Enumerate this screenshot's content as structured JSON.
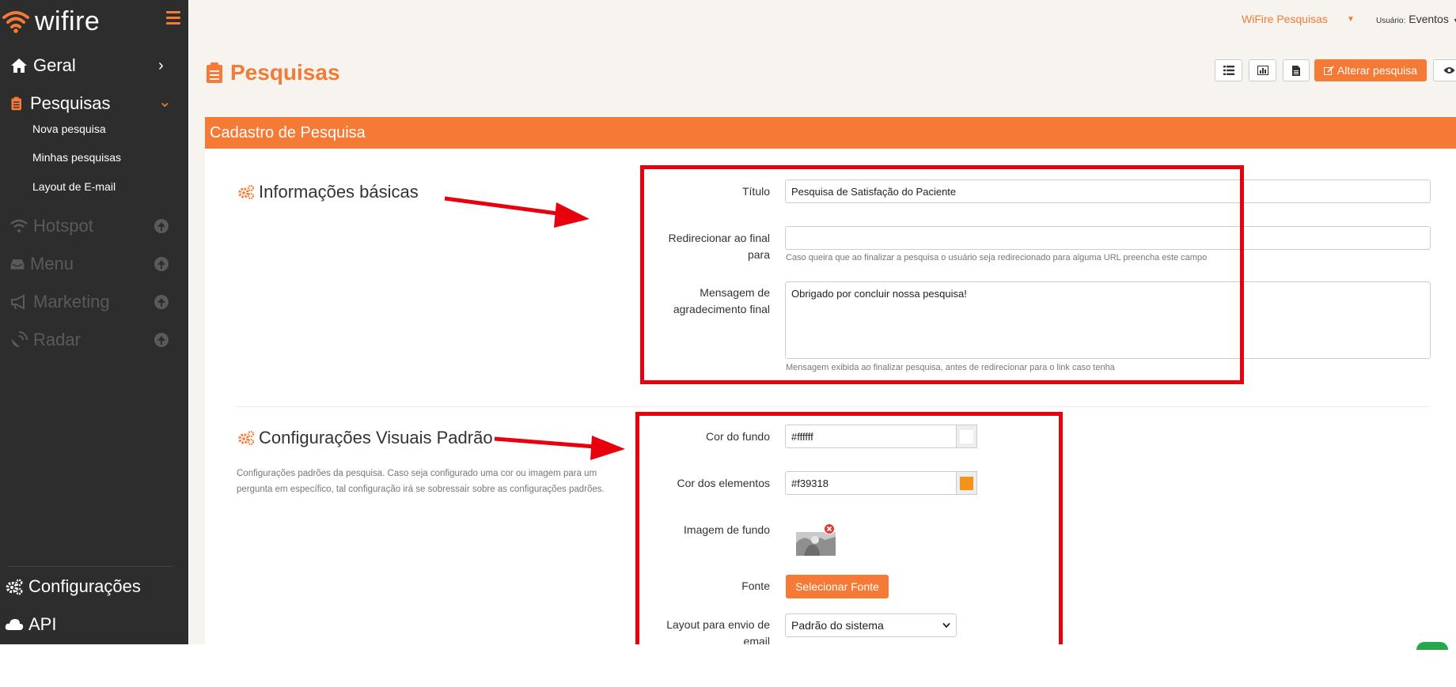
{
  "app": {
    "logo_text": "wifire"
  },
  "sidebar": {
    "items": [
      {
        "label": "Geral",
        "icon": "home-icon",
        "arrow": "›"
      },
      {
        "label": "Pesquisas",
        "icon": "clipboard-icon",
        "arrow": "⌄"
      },
      {
        "label": "Hotspot",
        "icon": "wifi-icon"
      },
      {
        "label": "Menu",
        "icon": "inbox-icon"
      },
      {
        "label": "Marketing",
        "icon": "bullhorn-icon"
      },
      {
        "label": "Radar",
        "icon": "satellite-icon"
      }
    ],
    "subitems": [
      "Nova pesquisa",
      "Minhas pesquisas",
      "Layout de E-mail"
    ],
    "bottom": [
      {
        "label": "Configurações",
        "icon": "cogs-icon"
      },
      {
        "label": "API",
        "icon": "cloud-icon"
      }
    ]
  },
  "topbar": {
    "company": "WiFire Pesquisas",
    "user_prefix": "Usuário:",
    "user_name": "Eventos"
  },
  "page": {
    "title": "Pesquisas",
    "alter_button": "Alterar pesquisa",
    "panel_title": "Cadastro de Pesquisa"
  },
  "basic": {
    "section_title": "Informações básicas",
    "titulo_label": "Título",
    "titulo_value": "Pesquisa de Satisfação do Paciente",
    "redirect_label_1": "Redirecionar ao final",
    "redirect_label_2": "para",
    "redirect_value": "",
    "redirect_help": "Caso queira que ao finalizar a pesquisa o usuário seja redirecionado para alguma URL preencha este campo",
    "msg_label_1": "Mensagem de",
    "msg_label_2": "agradecimento final",
    "msg_value": "Obrigado por concluir nossa pesquisa!",
    "msg_help": "Mensagem exibida ao finalizar pesquisa, antes de redirecionar para o link caso tenha"
  },
  "visual": {
    "section_title": "Configurações Visuais Padrão",
    "desc_1": "Configurações padrões da pesquisa. Caso seja configurado uma cor ou imagem para um",
    "desc_2": "pergunta em específico, tal configuração irá se sobressair sobre as configurações padrões.",
    "bg_color_label": "Cor do fundo",
    "bg_color_value": "#ffffff",
    "el_color_label": "Cor dos elementos",
    "el_color_value": "#f39318",
    "bg_image_label": "Imagem de fundo",
    "font_label": "Fonte",
    "font_button": "Selecionar Fonte",
    "layout_label_1": "Layout para envio de",
    "layout_label_2": "email",
    "layout_value": "Padrão do sistema"
  },
  "colors": {
    "accent": "#f47a36",
    "sidebar": "#2d2d2d",
    "annotation": "#e8000d",
    "element_swatch": "#f39318"
  }
}
